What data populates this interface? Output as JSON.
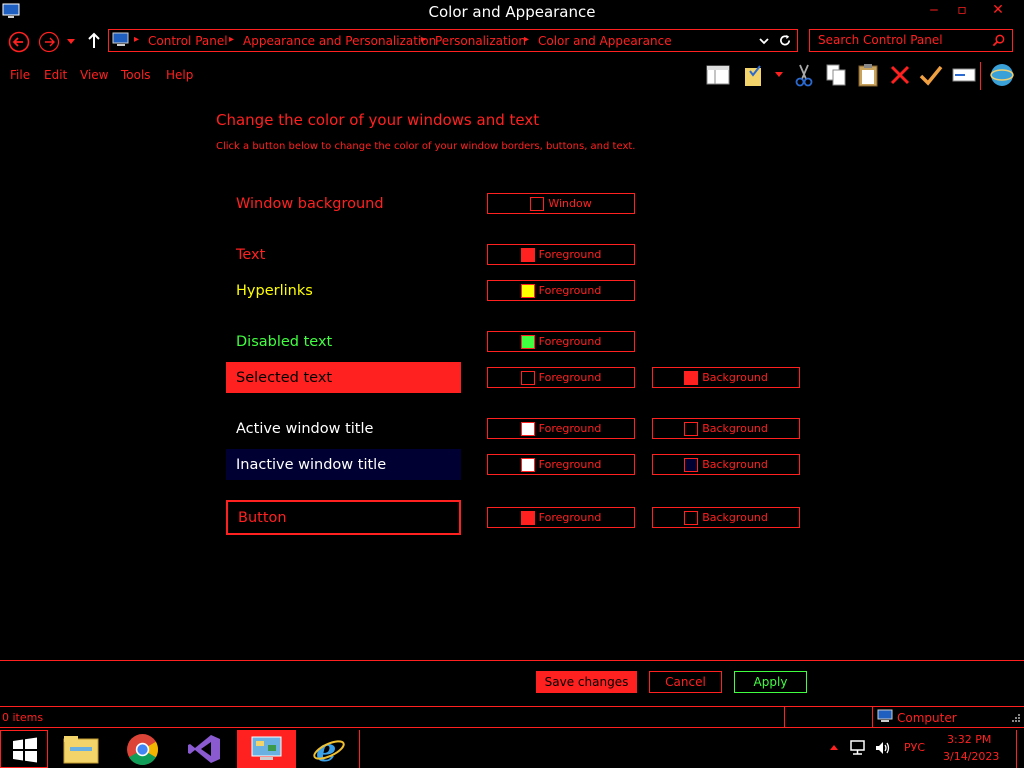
{
  "window": {
    "title": "Color and Appearance",
    "minimize": "‒",
    "maximize": "▫",
    "close": "✕"
  },
  "address": {
    "crumbs": [
      "Control Panel",
      "Appearance and Personalization",
      "Personalization",
      "Color and Appearance"
    ]
  },
  "search": {
    "placeholder": "Search Control Panel"
  },
  "menu": [
    "File",
    "Edit",
    "View",
    "Tools",
    "Help"
  ],
  "content": {
    "heading": "Change the color of your windows and text",
    "subheading": "Click a button below to change the color of your window borders, buttons, and text.",
    "rows": [
      {
        "label": "Window background",
        "btn1": "Window"
      },
      {
        "label": "Text",
        "btn1": "Foreground"
      },
      {
        "label": "Hyperlinks",
        "btn1": "Foreground"
      },
      {
        "label": "Disabled text",
        "btn1": "Foreground"
      },
      {
        "label": "Selected text",
        "btn1": "Foreground",
        "btn2": "Background"
      },
      {
        "label": "Active window title",
        "btn1": "Foreground",
        "btn2": "Background"
      },
      {
        "label": "Inactive window title",
        "btn1": "Foreground",
        "btn2": "Background"
      },
      {
        "label": "Button",
        "btn1": "Foreground",
        "btn2": "Background"
      }
    ]
  },
  "actions": {
    "save": "Save changes",
    "cancel": "Cancel",
    "apply": "Apply"
  },
  "status": {
    "items": "0 items",
    "location": "Computer"
  },
  "taskbar": {
    "time": "3:32 PM",
    "date": "3/14/2023",
    "lang": "РУС"
  },
  "colors": {
    "accent": "#ff2020",
    "hyperlink": "#ffff00",
    "disabled": "#40ff40",
    "selected_bg": "#ff2020",
    "inactive_bg": "#000033",
    "active_fg": "#ffffff"
  }
}
